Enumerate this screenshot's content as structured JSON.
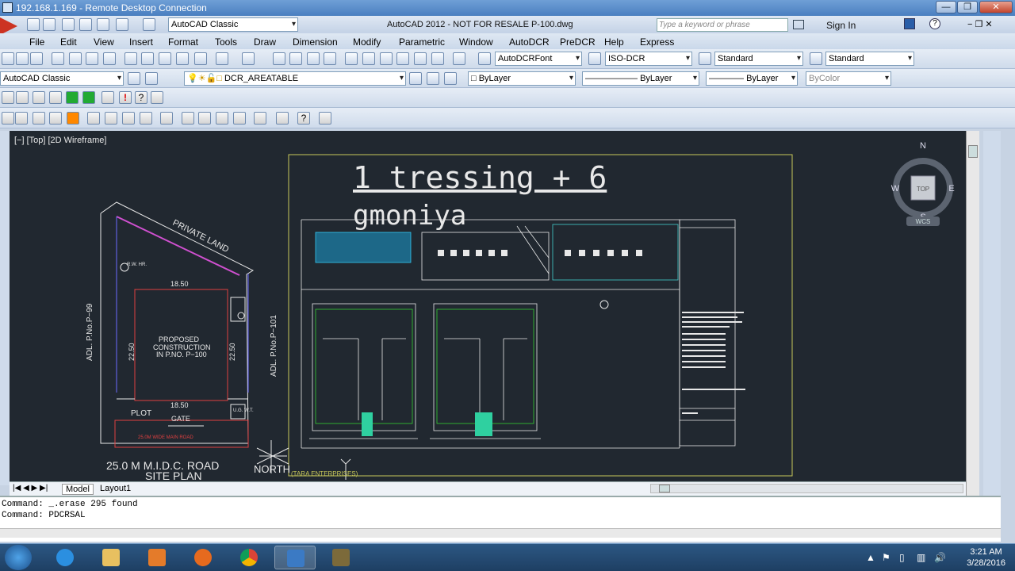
{
  "rdp": {
    "title": "192.168.1.169 - Remote Desktop Connection"
  },
  "autocad": {
    "workspace": "AutoCAD Classic",
    "title": "AutoCAD 2012 - NOT FOR RESALE    P-100.dwg",
    "search_placeholder": "Type a keyword or phrase",
    "sign_in": "Sign In"
  },
  "menus": [
    "File",
    "Edit",
    "View",
    "Insert",
    "Format",
    "Tools",
    "Draw",
    "Dimension",
    "Modify",
    "Parametric",
    "Window",
    "AutoDCR",
    "PreDCR",
    "Help",
    "Express"
  ],
  "styles": {
    "text_style": "AutoDCRFont",
    "dim_style": "ISO-DCR",
    "table_style": "Standard",
    "mleader_style": "Standard"
  },
  "layers": {
    "workspace2": "AutoCAD Classic",
    "current_layer": "DCR_AREATABLE",
    "color": "ByLayer",
    "linetype": "ByLayer",
    "lineweight": "ByLayer",
    "plotstyle": "ByColor"
  },
  "viewport": {
    "label": "[−] [Top] [2D Wireframe]"
  },
  "viewcube": {
    "n": "N",
    "s": "S",
    "e": "E",
    "w": "W",
    "top": "TOP",
    "wcs": "WCS"
  },
  "drawing": {
    "title_line1": "1 tressing + 6",
    "title_line2": "gmoniya",
    "private_land": "PRIVATE LAND",
    "plot_top": "18.50",
    "plot_bottom": "18.50",
    "plot_left": "22.50",
    "plot_right": "22.50",
    "proposed1": "PROPOSED",
    "proposed2": "CONSTRUCTION",
    "proposed3": "IN P.NO. P−100",
    "plot": "PLOT",
    "gate": "GATE",
    "ug": "U.G.\nW.T.",
    "rw": "R.W.\nHR.",
    "wide_road": "25.0M WIDE MAIN ROAD",
    "adl_left": "ADL. P.No.P−99",
    "adl_right": "ADL. P.No.P−101",
    "road": "25.0 M   M.I.D.C. ROAD",
    "site_plan": "SITE PLAN",
    "north": "NORTH",
    "firm": "(TARA ENTERPRISES)"
  },
  "tabs": {
    "model": "Model",
    "layout1": "Layout1"
  },
  "command": {
    "line1": "Command: _.erase 295 found",
    "line2": "Command: PDCRSAL"
  },
  "clock": {
    "time": "3:21 AM",
    "date": "3/28/2016"
  }
}
